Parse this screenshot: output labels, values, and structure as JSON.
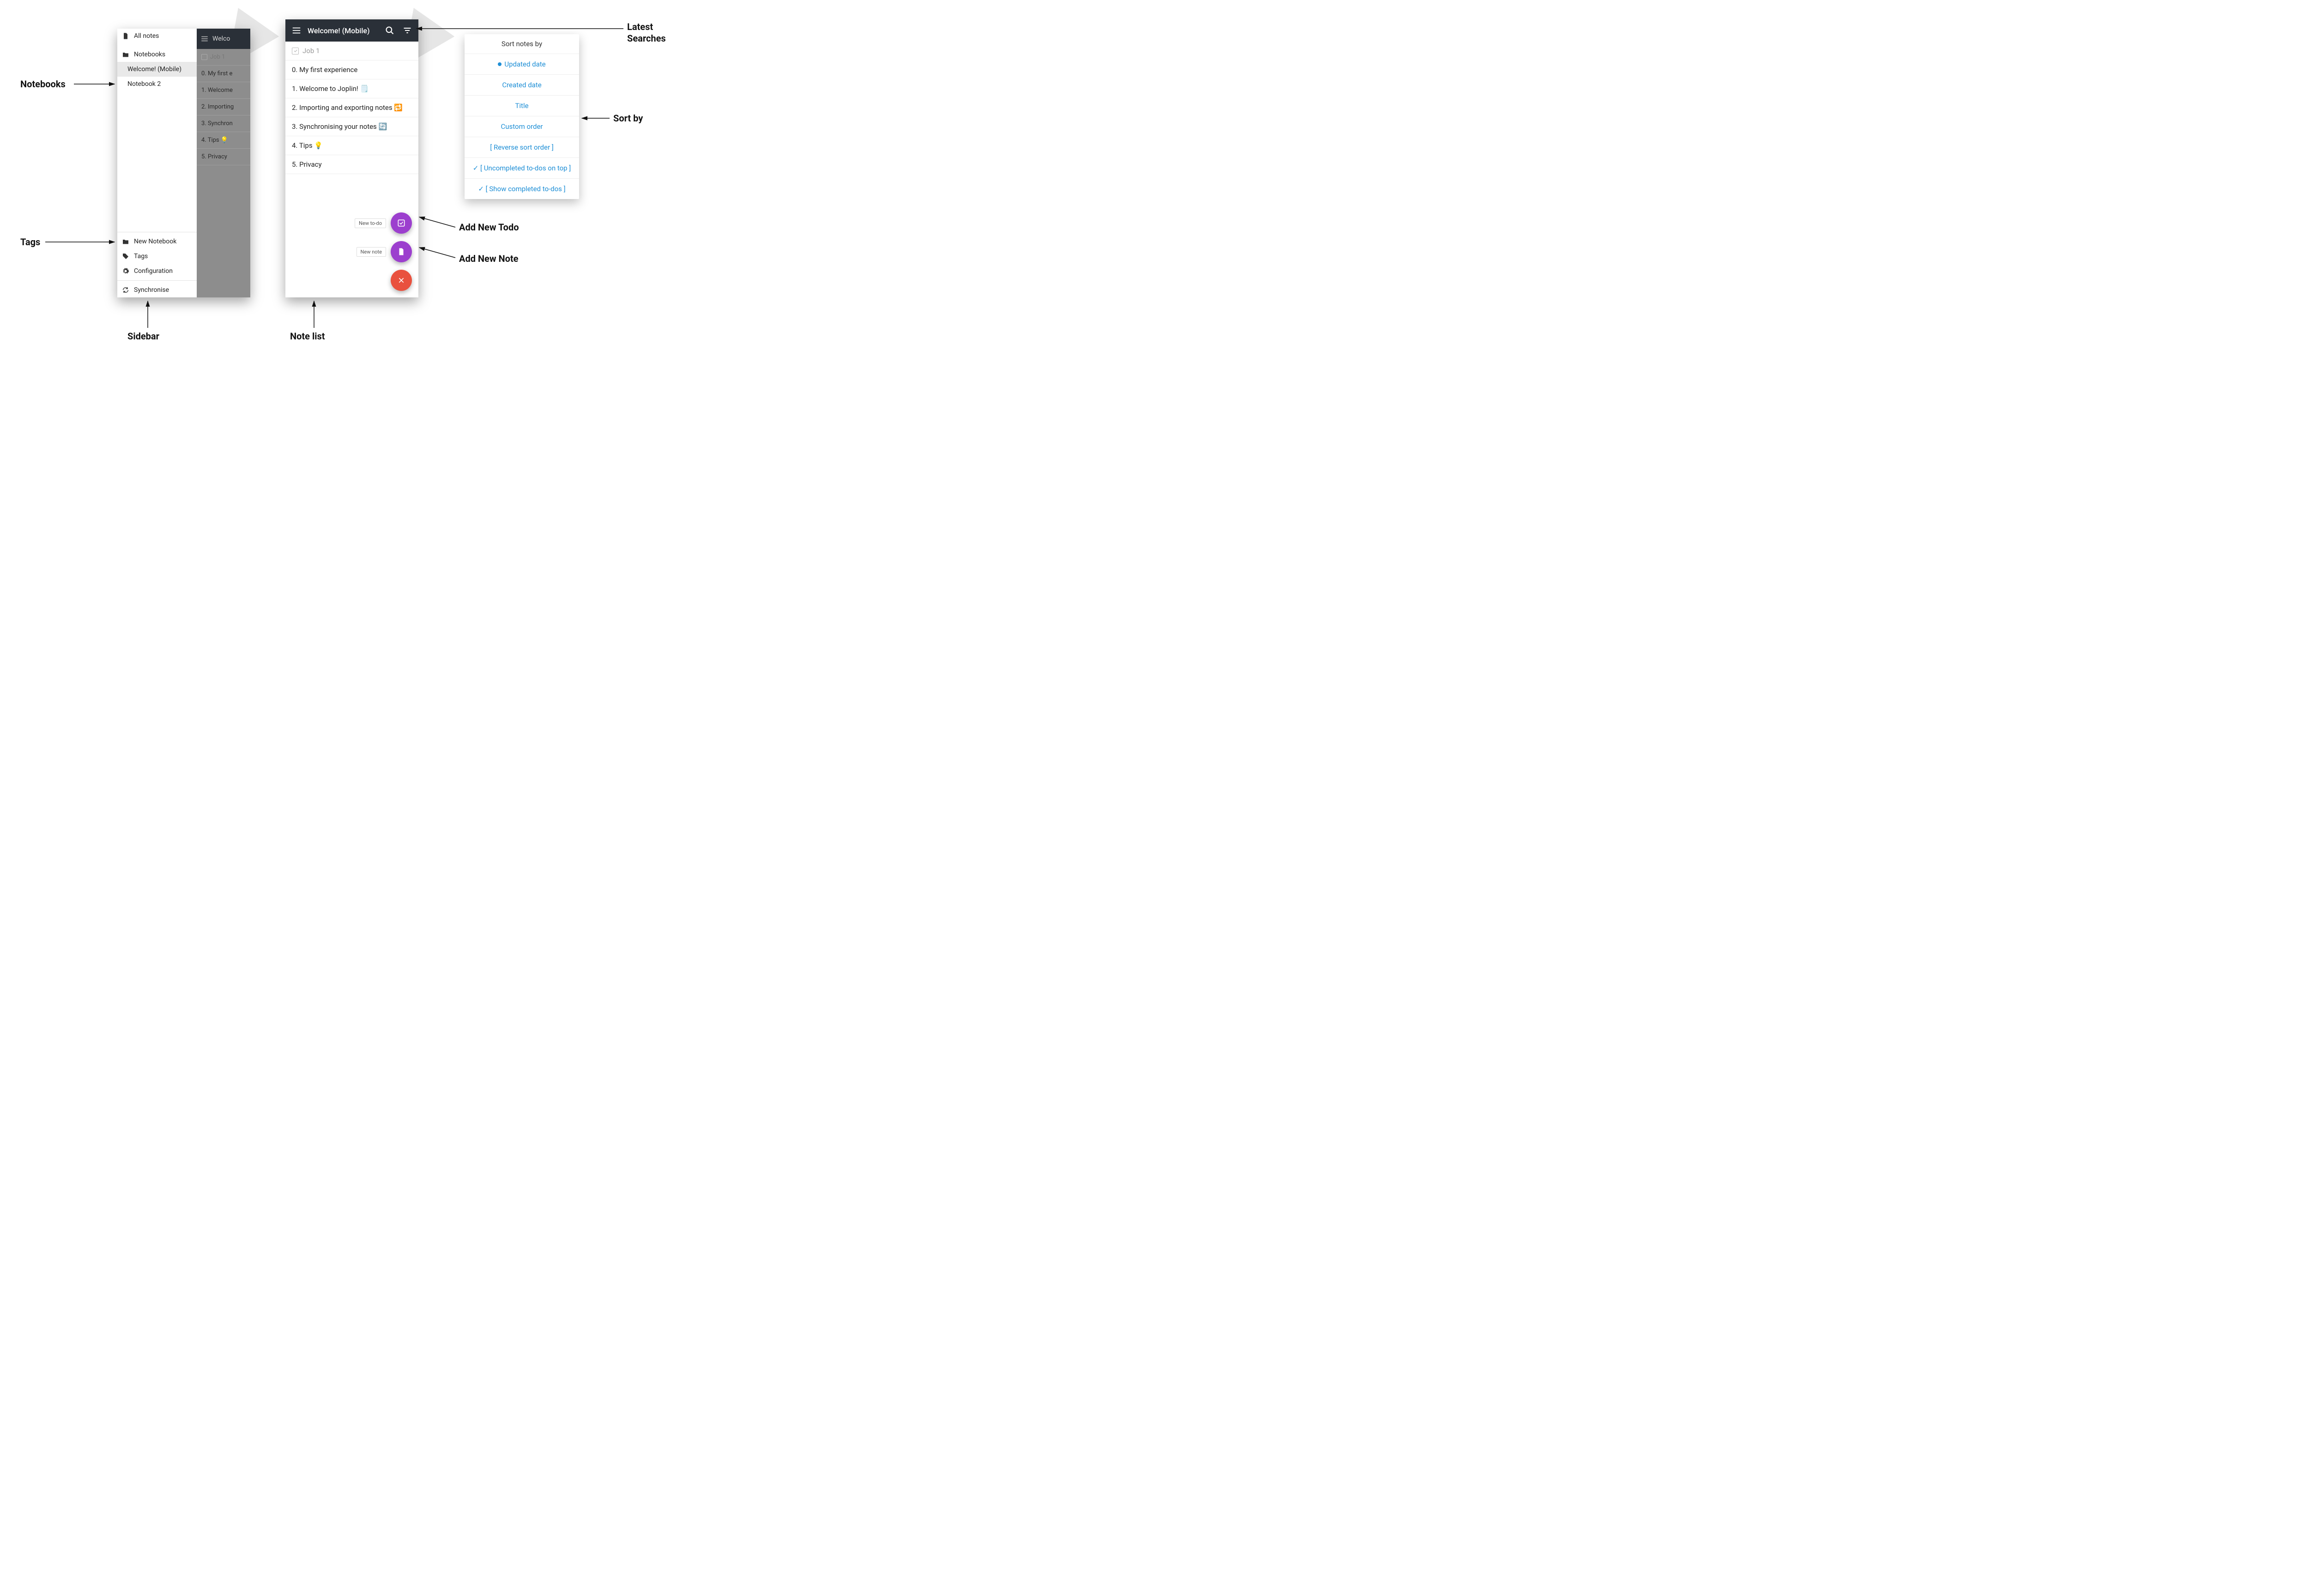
{
  "sidebar": {
    "all_notes": "All notes",
    "notebooks_label": "Notebooks",
    "notebooks": [
      {
        "name": "Welcome! (Mobile)",
        "active": true
      },
      {
        "name": "Notebook 2",
        "active": false
      }
    ],
    "new_notebook": "New Notebook",
    "tags": "Tags",
    "configuration": "Configuration",
    "synchronise": "Synchronise",
    "behind_title": "Welco",
    "behind_rows": [
      "Job 1",
      "0. My first e",
      "1. Welcome",
      "2. Importing",
      "3. Synchron",
      "4. Tips 💡",
      "5. Privacy"
    ]
  },
  "notelist": {
    "title": "Welcome! (Mobile)",
    "rows": [
      {
        "text": "Job 1",
        "todo": true
      },
      {
        "text": "0. My first experience"
      },
      {
        "text": "1. Welcome to Joplin! 🗒️"
      },
      {
        "text": "2. Importing and exporting notes 🔁"
      },
      {
        "text": "3. Synchronising your notes 🔄"
      },
      {
        "text": "4. Tips 💡"
      },
      {
        "text": "5. Privacy"
      }
    ],
    "fab_new_todo": "New to-do",
    "fab_new_note": "New note"
  },
  "sort": {
    "title": "Sort notes by",
    "items": [
      {
        "label": "Updated date",
        "selected": true
      },
      {
        "label": "Created date"
      },
      {
        "label": "Title"
      },
      {
        "label": "Custom order"
      },
      {
        "label": "[ Reverse sort order ]"
      },
      {
        "label": "✓ [ Uncompleted to-dos on top ]"
      },
      {
        "label": "✓ [ Show completed to-dos ]"
      }
    ]
  },
  "callouts": {
    "notebooks": "Notebooks",
    "tags": "Tags",
    "sidebar": "Sidebar",
    "notelist": "Note list",
    "latest_searches": "Latest Searches",
    "sort_by": "Sort by",
    "add_new_todo": "Add New Todo",
    "add_new_note": "Add New Note"
  }
}
